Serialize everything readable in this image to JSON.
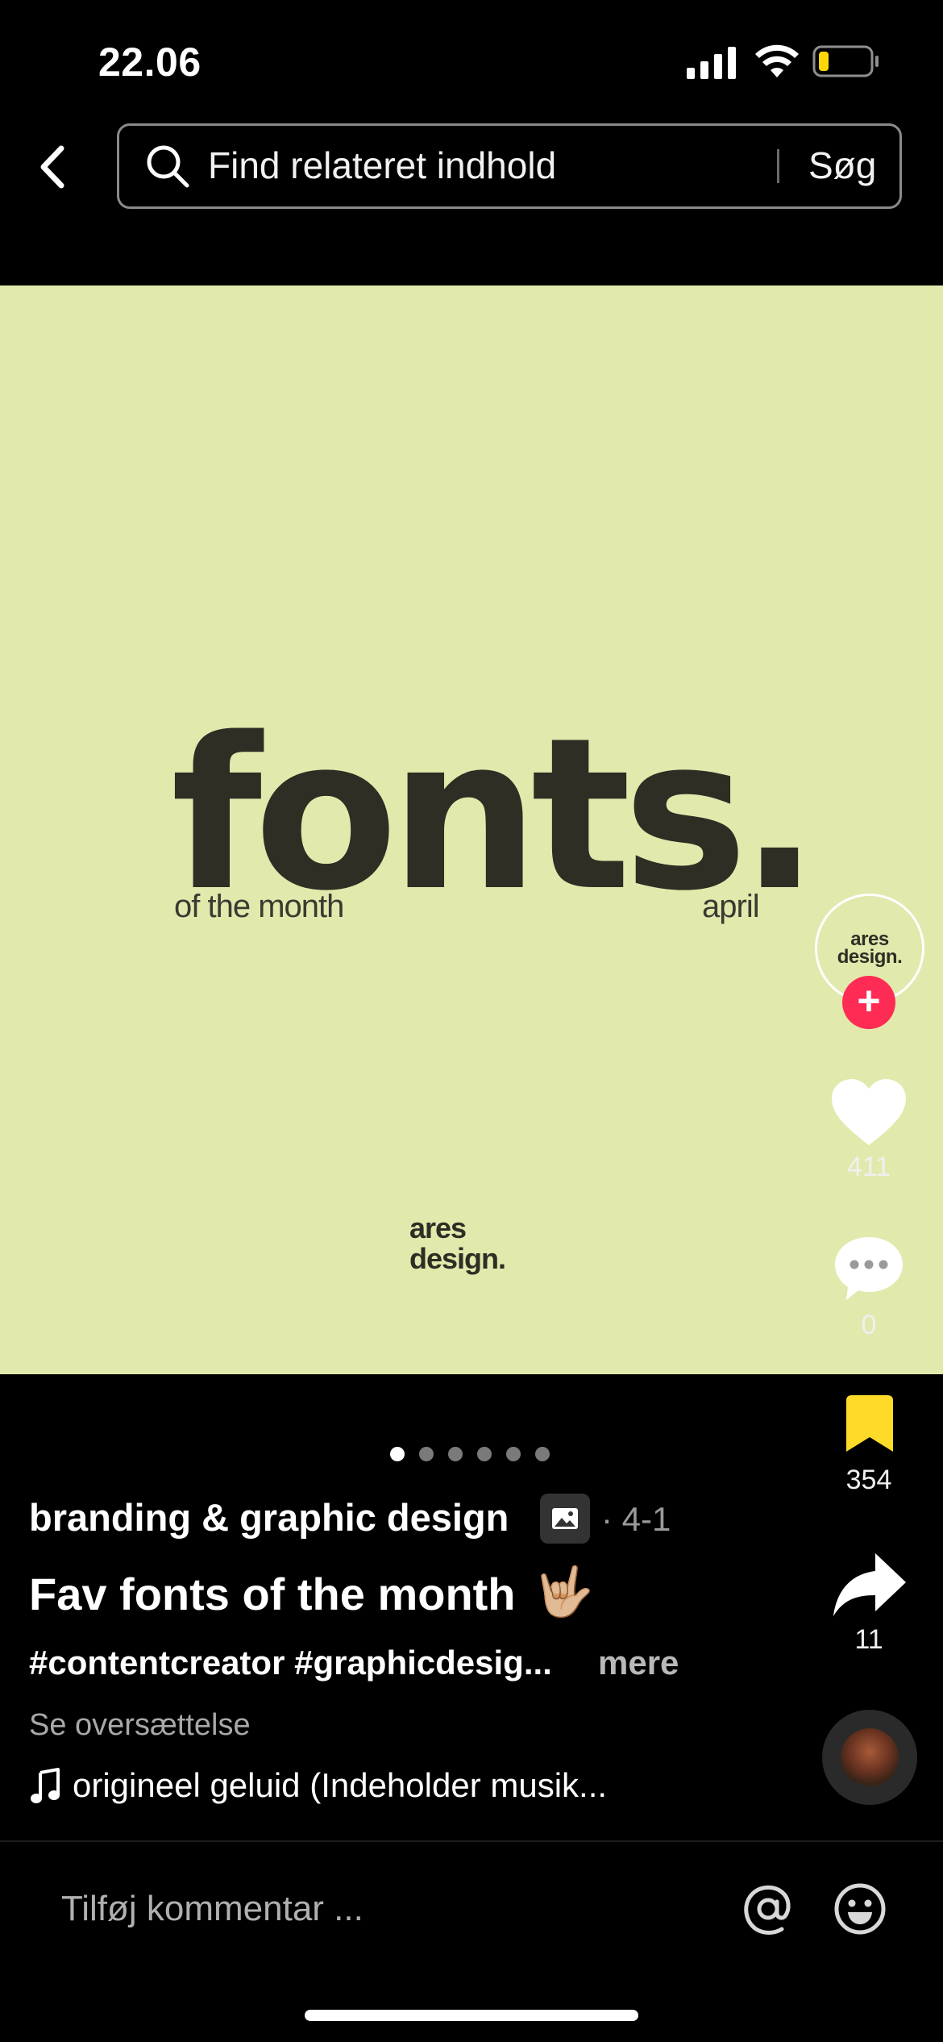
{
  "status_bar": {
    "time": "22.06"
  },
  "search": {
    "placeholder": "Find relateret indhold",
    "button_label": "Søg"
  },
  "media": {
    "headline": "fonts.",
    "left_caption": "of the month",
    "right_caption": "april",
    "logo_line1": "ares",
    "logo_line2": "design.",
    "background_color": "#e2e9ad",
    "slide_count": 6,
    "active_slide": 1
  },
  "profile": {
    "avatar_line1": "ares",
    "avatar_line2": "design.",
    "follow_symbol": "+"
  },
  "actions": {
    "likes": "411",
    "comments": "0",
    "saves": "354",
    "shares": "11",
    "accent_color": "#fe2c55",
    "bookmark_color": "#fedb28"
  },
  "caption": {
    "author": "branding & graphic design",
    "date": "· 4-1",
    "title": "Fav fonts of the month",
    "title_emoji": "🤟🏼",
    "hashtags": "#contentcreator #graphicdesig...",
    "more_label": "mere",
    "translate_label": "Se oversættelse",
    "music": "origineel geluid (Indeholder musik..."
  },
  "comment_bar": {
    "placeholder": "Tilføj kommentar ..."
  }
}
